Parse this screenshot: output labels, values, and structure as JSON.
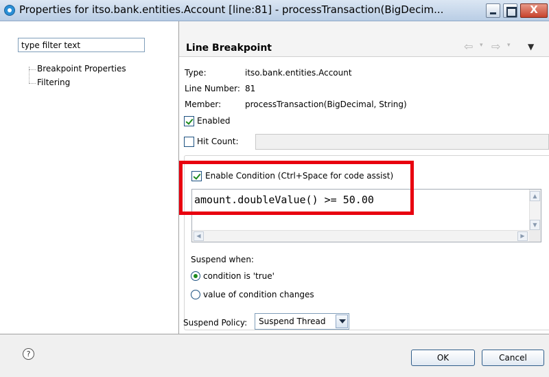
{
  "window": {
    "title": "Properties for itso.bank.entities.Account [line:81] - processTransaction(BigDecim...",
    "close_glyph": "X"
  },
  "left": {
    "filter_placeholder": "type filter text",
    "tree": [
      "Breakpoint Properties",
      "Filtering"
    ]
  },
  "right": {
    "title": "Line Breakpoint",
    "nav": {
      "back": "⇦",
      "forward": "⇨",
      "dropdown": "▾",
      "menu": "▼"
    },
    "type_label": "Type:",
    "type_value": "itso.bank.entities.Account",
    "line_label": "Line Number:",
    "line_value": "81",
    "member_label": "Member:",
    "member_value": "processTransaction(BigDecimal, String)",
    "enabled_label": "Enabled",
    "enabled_checked": true,
    "hitcount_label": "Hit Count:",
    "hitcount_checked": false,
    "condition": {
      "label": "Enable Condition (Ctrl+Space for code assist)",
      "checked": true,
      "code": "amount.doubleValue() >= 50.00"
    },
    "suspend_when_label": "Suspend when:",
    "suspend_options": [
      "condition is 'true'",
      "value of condition changes"
    ],
    "suspend_selected": 0,
    "policy_label": "Suspend Policy:",
    "policy_value": "Suspend Thread"
  },
  "buttons": {
    "help": "?",
    "ok": "OK",
    "cancel": "Cancel"
  },
  "colors": {
    "highlight": "#e8000f",
    "accent": "#2a8fd6"
  }
}
